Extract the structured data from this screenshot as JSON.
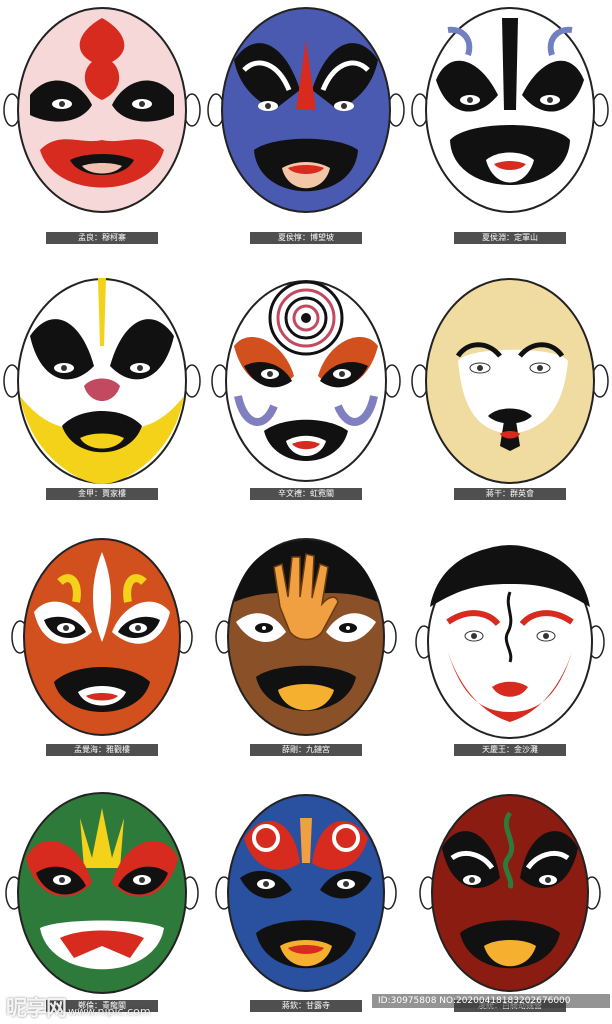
{
  "masks": [
    {
      "caption": "孟良：穆柯寨",
      "icon": "red-white-opera-mask"
    },
    {
      "caption": "夏侯惇：博望坡",
      "icon": "blue-opera-mask"
    },
    {
      "caption": "夏侯淵：定軍山",
      "icon": "white-black-opera-mask"
    },
    {
      "caption": "金甲：賈家樓",
      "icon": "yellow-white-opera-mask"
    },
    {
      "caption": "辛文禮：虹霓關",
      "icon": "concentric-forehead-opera-mask"
    },
    {
      "caption": "蔣干：群英會",
      "icon": "clown-opera-mask"
    },
    {
      "caption": "孟覺海：雅觀樓",
      "icon": "orange-red-opera-mask"
    },
    {
      "caption": "薛剛：九鏈宮",
      "icon": "hand-forehead-opera-mask"
    },
    {
      "caption": "天慶王：金沙灘",
      "icon": "white-red-black-cap-opera-mask"
    },
    {
      "caption": "鄭倫：青龍關",
      "icon": "green-opera-mask"
    },
    {
      "caption": "蔣欽：甘露寺",
      "icon": "blue-red-opera-mask"
    },
    {
      "caption": "凌統：百騎劫魏營",
      "icon": "dark-red-opera-mask"
    }
  ],
  "watermark": {
    "logo": "昵享网",
    "site": "www.nipic.com",
    "id_text": "ID:30975808 NO:20200418183202676000"
  },
  "colors": {
    "caption_bg": "#4f4f4f",
    "red": "#d62b1e",
    "blue": "#4a5ab0",
    "yellow": "#f5d21a",
    "green": "#2e7a3a",
    "skin": "#f0dba0",
    "orange": "#d2501e"
  }
}
